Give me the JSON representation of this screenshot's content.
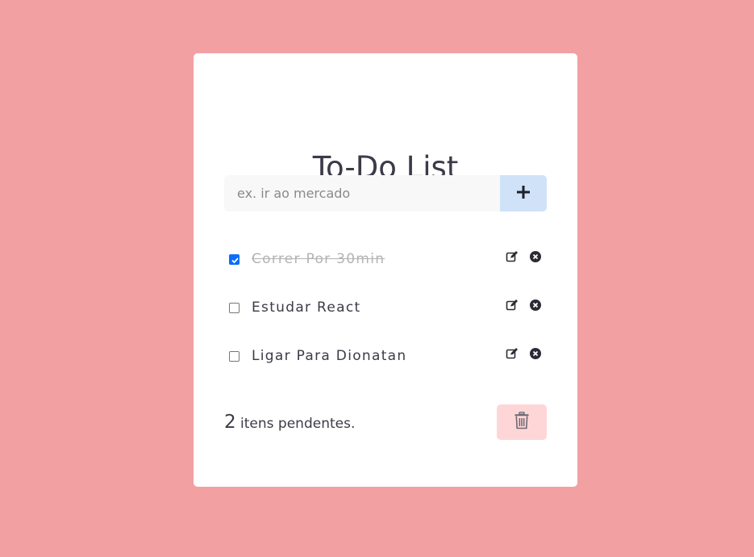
{
  "header": {
    "title": "To-Do List"
  },
  "add_form": {
    "placeholder": "ex. ir ao mercado",
    "value": "",
    "add_icon": "plus-icon"
  },
  "todos": [
    {
      "text": "Correr Por 30min",
      "done": true
    },
    {
      "text": "Estudar React",
      "done": false
    },
    {
      "text": "Ligar Para Dionatan",
      "done": false
    }
  ],
  "footer": {
    "pending_count": "2",
    "pending_label": "itens pendentes.",
    "clear_icon": "trash-icon"
  },
  "colors": {
    "background": "#f2a0a1",
    "card": "#ffffff",
    "add_button": "#cfe2f7",
    "clear_button": "#ffd6d8",
    "text": "#3d3a48",
    "done_text": "#b3b3b3",
    "checkbox_checked": "#0a6cff"
  }
}
